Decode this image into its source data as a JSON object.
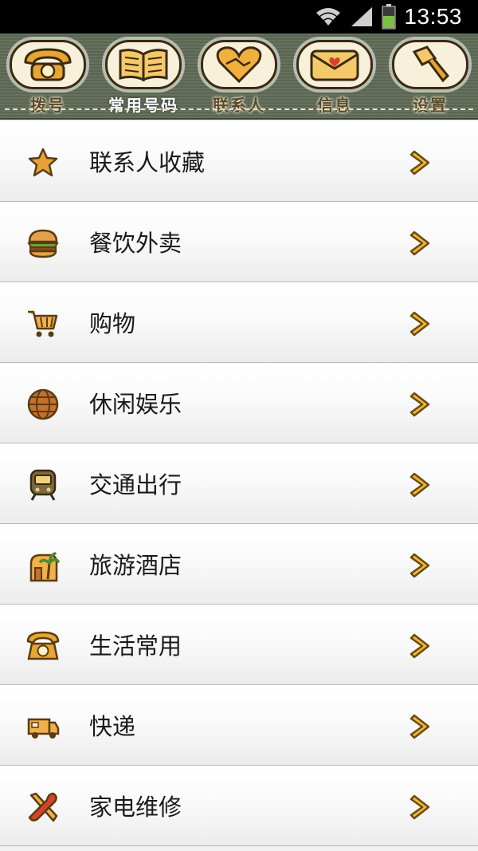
{
  "status_bar": {
    "time": "13:53",
    "wifi_icon": "wifi-icon",
    "signal_icon": "signal-icon",
    "battery_icon": "battery-icon"
  },
  "tabs": [
    {
      "label": "拨号",
      "icon": "rotary-phone-icon",
      "active": false
    },
    {
      "label": "常用号码",
      "icon": "open-book-icon",
      "active": true
    },
    {
      "label": "联系人",
      "icon": "handshake-heart-icon",
      "active": false
    },
    {
      "label": "信息",
      "icon": "envelope-heart-icon",
      "active": false
    },
    {
      "label": "设置",
      "icon": "wrench-icon",
      "active": false
    }
  ],
  "list": [
    {
      "label": "联系人收藏",
      "icon": "star-icon"
    },
    {
      "label": "餐饮外卖",
      "icon": "burger-icon"
    },
    {
      "label": "购物",
      "icon": "shopping-cart-icon"
    },
    {
      "label": "休闲娱乐",
      "icon": "globe-icon"
    },
    {
      "label": "交通出行",
      "icon": "train-icon"
    },
    {
      "label": "旅游酒店",
      "icon": "palm-tree-icon"
    },
    {
      "label": "生活常用",
      "icon": "telephone-icon"
    },
    {
      "label": "快递",
      "icon": "delivery-truck-icon"
    },
    {
      "label": "家电维修",
      "icon": "tools-icon"
    }
  ],
  "colors": {
    "accent_orange": "#e0a22a",
    "icon_brown": "#5a3c12",
    "tabbar_green": "#5f6a55"
  }
}
